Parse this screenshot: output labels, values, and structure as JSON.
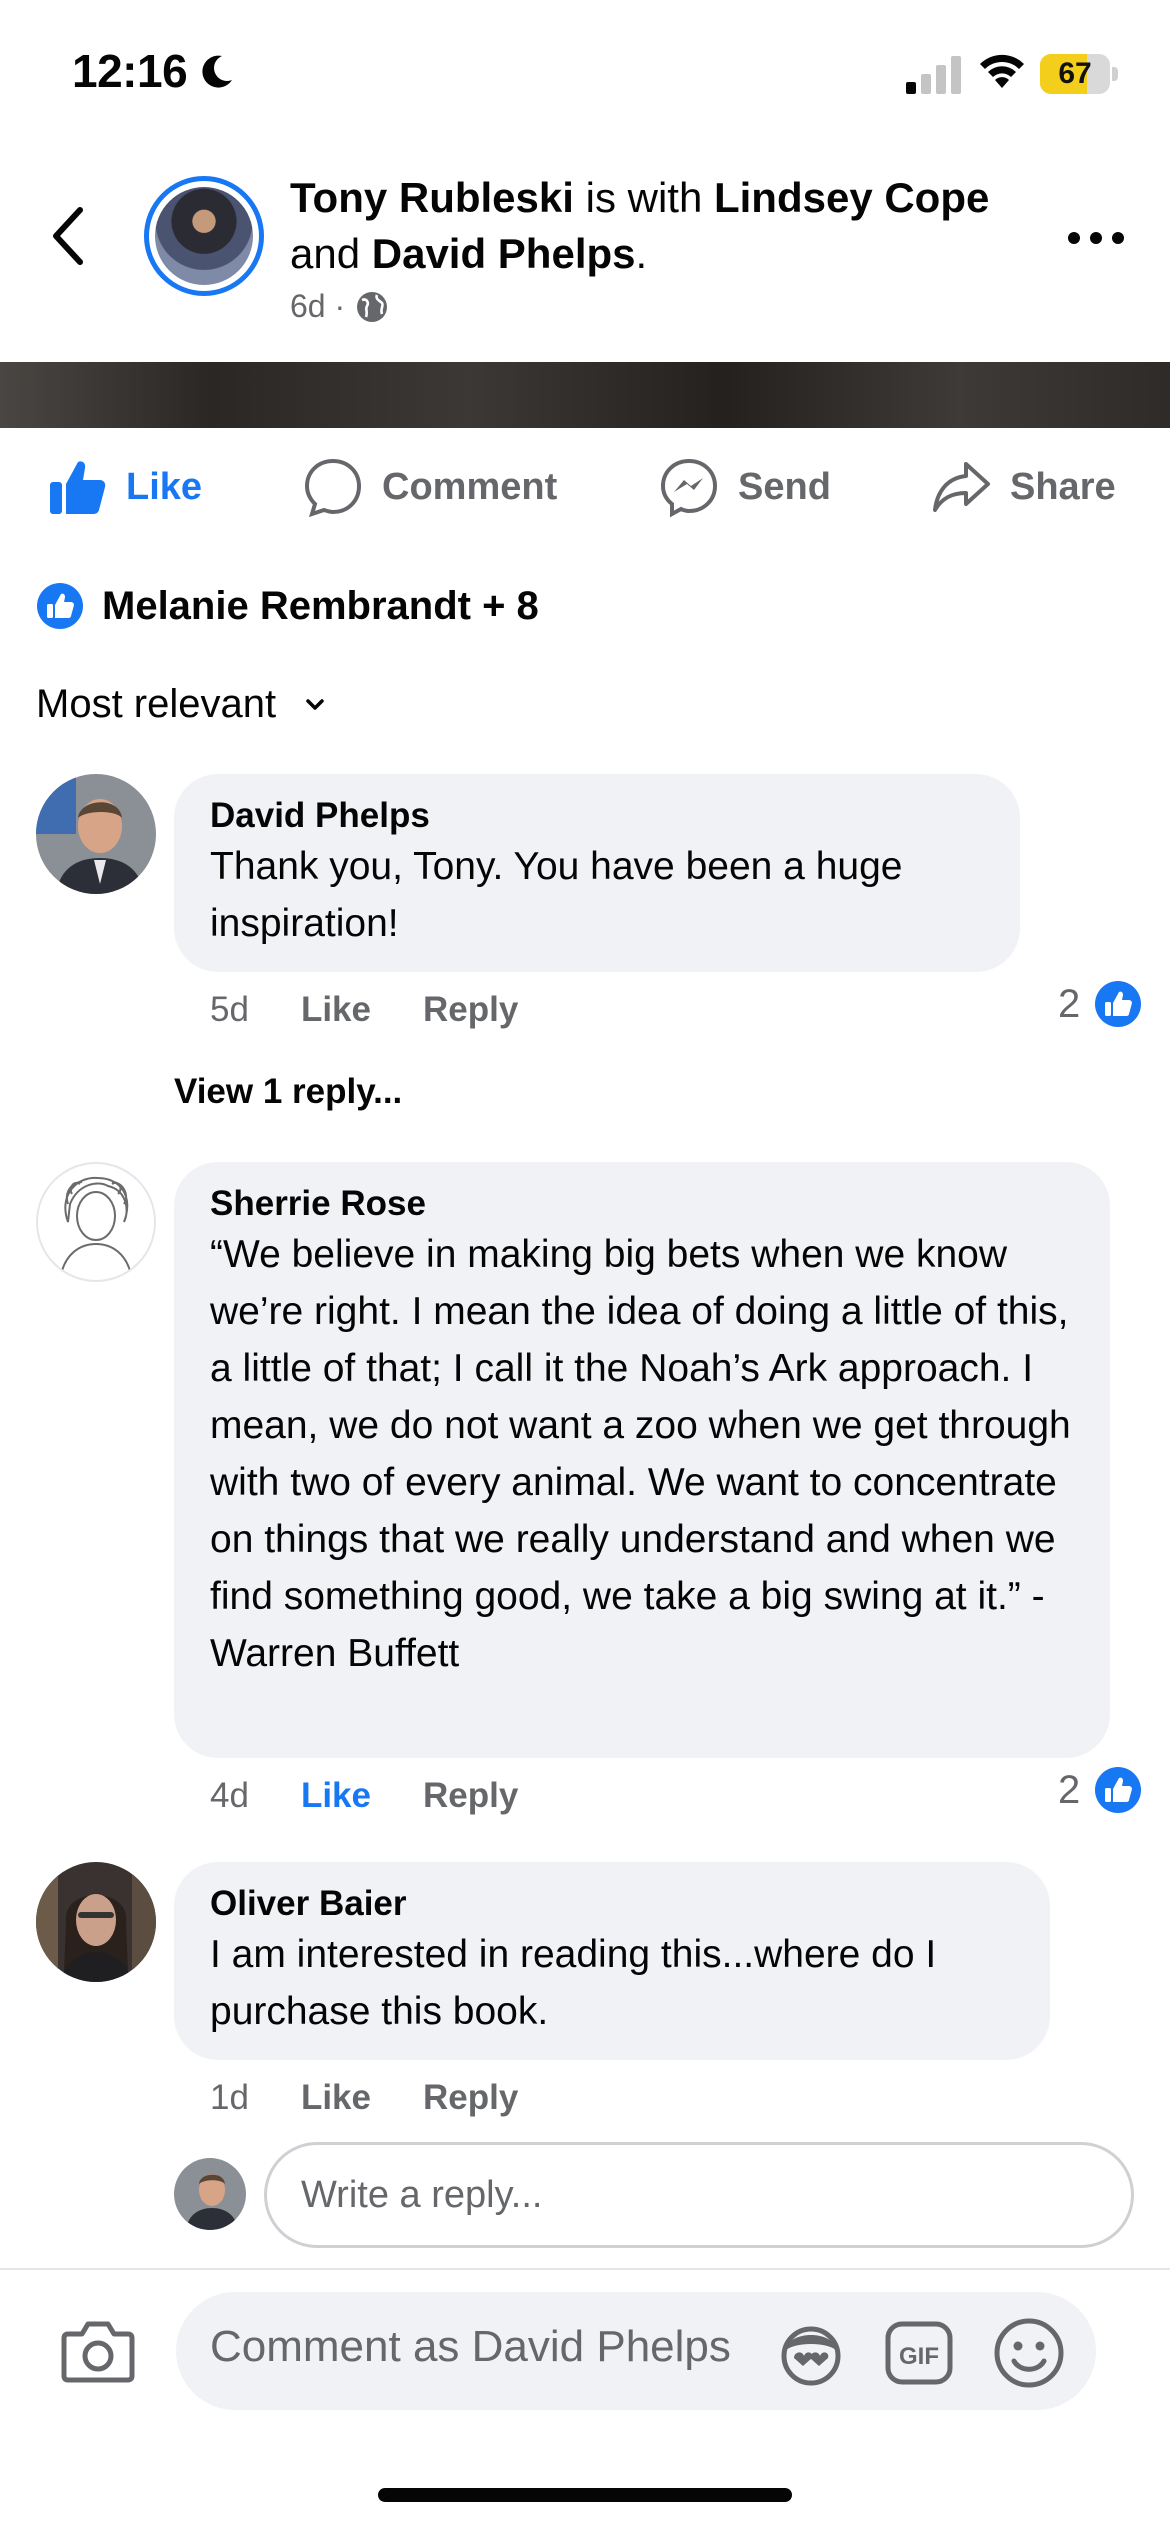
{
  "status_bar": {
    "time": "12:16",
    "battery": "67",
    "battery_level": 0.67
  },
  "post_header": {
    "author": "Tony Rubleski",
    "with_text": " is with ",
    "tagged_1": "Lindsey Cope",
    "and_text": "and ",
    "tagged_2": "David Phelps",
    "period": ".",
    "time": "6d ·",
    "visibility_icon": "globe-icon",
    "back_icon": "chevron-left-icon",
    "more_icon": "more-horizontal-icon"
  },
  "actions": {
    "like": "Like",
    "comment": "Comment",
    "send": "Send",
    "share": "Share"
  },
  "reactions": {
    "summary": "Melanie Rembrandt + 8"
  },
  "sort": {
    "label": "Most relevant"
  },
  "comments": [
    {
      "name": "David Phelps",
      "text": "Thank you, Tony.  You have been a huge inspiration!",
      "time": "5d",
      "like": "Like",
      "reply": "Reply",
      "reaction_count": "2",
      "view_replies": "View 1 reply..."
    },
    {
      "name": "Sherrie Rose",
      "text": "“We believe in making big bets when we know we’re right. I mean the idea of doing a little of this, a little of that; I call it the Noah’s Ark approach. I mean, we do not want a zoo when we get through with two of every animal. We want to concentrate on things that we really understand and when we find something good, we take a big swing at it.” -Warren Buffett",
      "time": "4d",
      "like": "Like",
      "reply": "Reply",
      "reaction_count": "2"
    },
    {
      "name": "Oliver Baier",
      "text": "I am interested in reading this...where do I purchase this book.",
      "time": "1d",
      "like": "Like",
      "reply": "Reply"
    }
  ],
  "reply_field": {
    "placeholder": "Write a reply..."
  },
  "composer": {
    "placeholder": "Comment as David Phelps"
  },
  "colors": {
    "accent": "#1877f2",
    "bubble": "#f0f2f5",
    "muted": "#65676b",
    "battery": "#f3cf1b"
  }
}
